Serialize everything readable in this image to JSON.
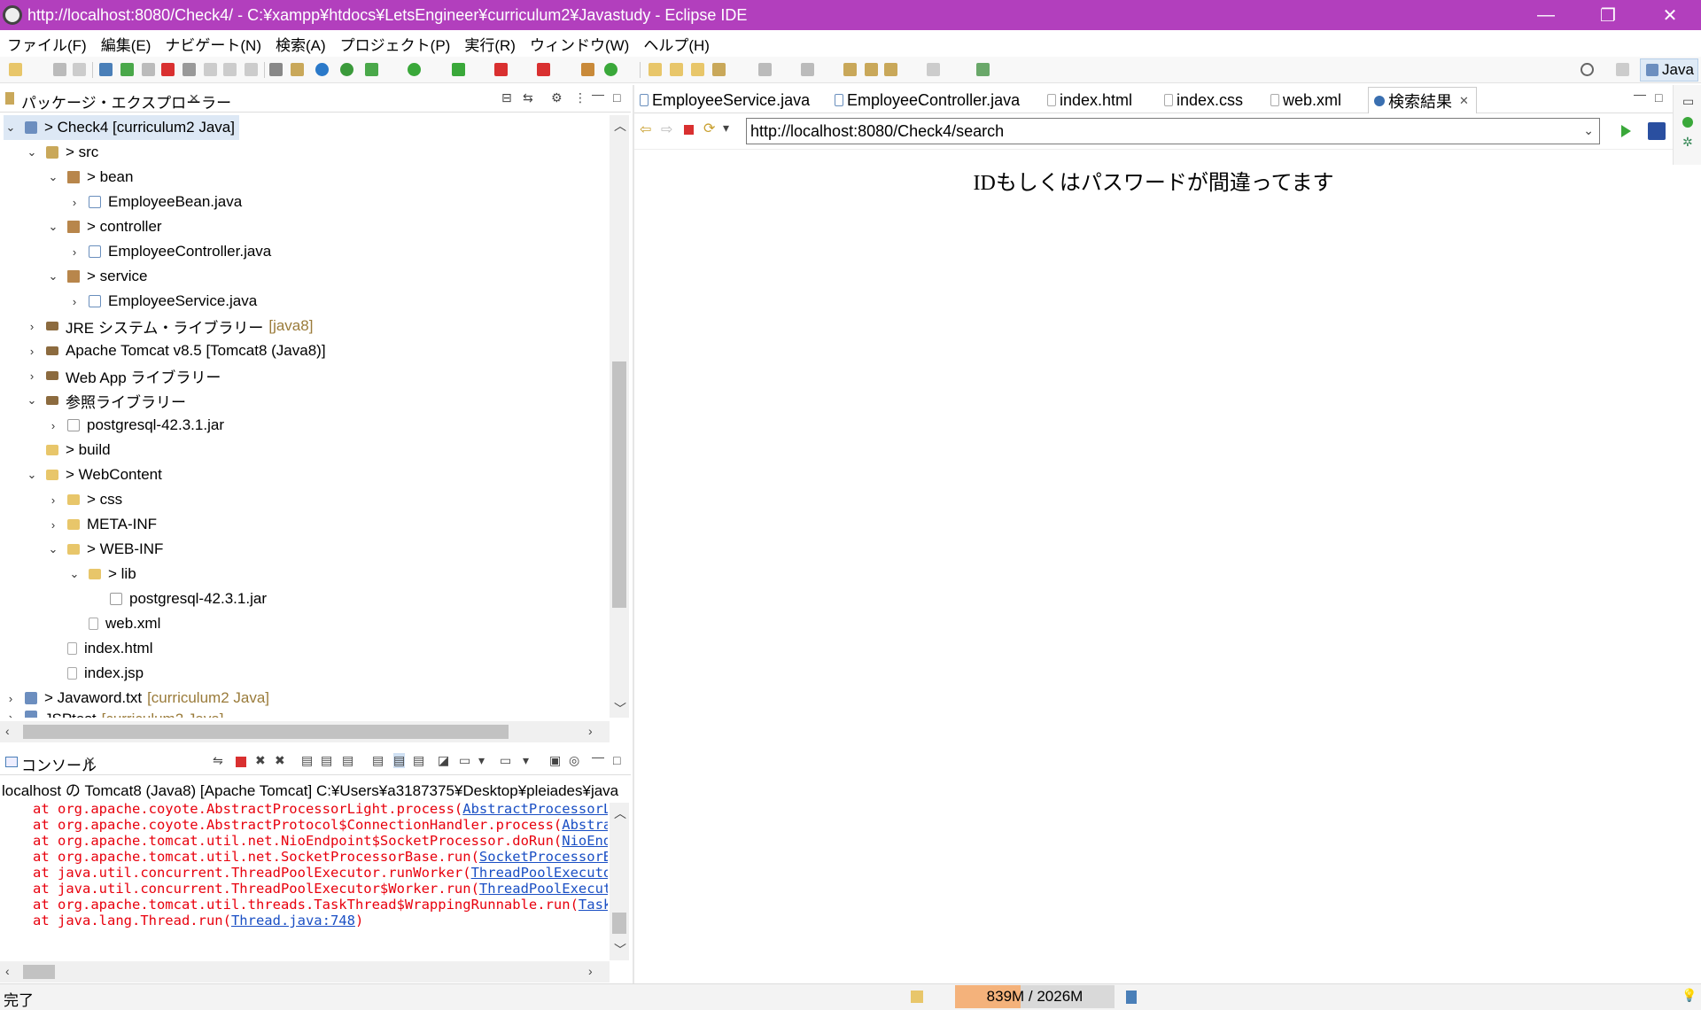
{
  "window": {
    "title": "http://localhost:8080/Check4/ - C:¥xampp¥htdocs¥LetsEngineer¥curriculum2¥Javastudy - Eclipse IDE",
    "minimize": "—",
    "restore": "❐",
    "close": "✕"
  },
  "menu": [
    "ファイル(F)",
    "編集(E)",
    "ナビゲート(N)",
    "検索(A)",
    "プロジェクト(P)",
    "実行(R)",
    "ウィンドウ(W)",
    "ヘルプ(H)"
  ],
  "perspective": {
    "label": "Java",
    "icon": "java-perspective-icon"
  },
  "package_explorer": {
    "title": "パッケージ・エクスプローラー",
    "items": [
      {
        "label": "> Check4 [curriculum2 Java]",
        "decoration": "",
        "icon": "project-icon",
        "twisty": "⌄",
        "selected": true
      },
      {
        "label": "> src",
        "decoration": "",
        "icon": "source-folder-icon",
        "twisty": "⌄"
      },
      {
        "label": "> bean",
        "decoration": "",
        "icon": "package-icon",
        "twisty": "⌄"
      },
      {
        "label": "EmployeeBean.java",
        "decoration": "",
        "icon": "java-file-icon",
        "twisty": "›"
      },
      {
        "label": "> controller",
        "decoration": "",
        "icon": "package-icon",
        "twisty": "⌄"
      },
      {
        "label": "EmployeeController.java",
        "decoration": "",
        "icon": "java-file-icon",
        "twisty": "›"
      },
      {
        "label": "> service",
        "decoration": "",
        "icon": "package-icon",
        "twisty": "⌄"
      },
      {
        "label": "EmployeeService.java",
        "decoration": "",
        "icon": "java-file-icon",
        "twisty": "›"
      },
      {
        "label": "JRE システム・ライブラリー",
        "decoration": "[java8]",
        "icon": "library-icon",
        "twisty": "›"
      },
      {
        "label": "Apache Tomcat v8.5 [Tomcat8 (Java8)]",
        "decoration": "",
        "icon": "library-icon",
        "twisty": "›"
      },
      {
        "label": "Web App ライブラリー",
        "decoration": "",
        "icon": "library-icon",
        "twisty": "›"
      },
      {
        "label": "参照ライブラリー",
        "decoration": "",
        "icon": "library-icon",
        "twisty": "⌄"
      },
      {
        "label": "postgresql-42.3.1.jar",
        "decoration": "",
        "icon": "jar-icon",
        "twisty": "›"
      },
      {
        "label": "> build",
        "decoration": "",
        "icon": "folder-icon",
        "twisty": ""
      },
      {
        "label": "> WebContent",
        "decoration": "",
        "icon": "folder-icon",
        "twisty": "⌄"
      },
      {
        "label": "> css",
        "decoration": "",
        "icon": "folder-icon",
        "twisty": "›"
      },
      {
        "label": "META-INF",
        "decoration": "",
        "icon": "folder-icon",
        "twisty": "›"
      },
      {
        "label": "> WEB-INF",
        "decoration": "",
        "icon": "folder-icon",
        "twisty": "⌄"
      },
      {
        "label": "> lib",
        "decoration": "",
        "icon": "folder-icon",
        "twisty": "⌄"
      },
      {
        "label": "postgresql-42.3.1.jar",
        "decoration": "",
        "icon": "jar-icon",
        "twisty": ""
      },
      {
        "label": "web.xml",
        "decoration": "",
        "icon": "xml-file-icon",
        "twisty": ""
      },
      {
        "label": "index.html",
        "decoration": "",
        "icon": "html-file-icon",
        "twisty": ""
      },
      {
        "label": "index.jsp",
        "decoration": "",
        "icon": "jsp-file-icon",
        "twisty": ""
      },
      {
        "label": "> Javaword.txt",
        "decoration": "[curriculum2 Java]",
        "icon": "project-icon",
        "twisty": "›"
      },
      {
        "label": "JSPtest",
        "decoration": "[curriculum2 Java]",
        "icon": "project-icon",
        "twisty": "›"
      }
    ]
  },
  "console": {
    "title": "コンソール",
    "description": "localhost の Tomcat8 (Java8) [Apache Tomcat] C:¥Users¥a3187375¥Desktop¥pleiades¥java",
    "lines": [
      {
        "prefix": "at org.apache.coyote.AbstractProcessorLight.process(",
        "link": "AbstractProcessorLig"
      },
      {
        "prefix": "at org.apache.coyote.AbstractProtocol$ConnectionHandler.process(",
        "link": "Abstract"
      },
      {
        "prefix": "at org.apache.tomcat.util.net.NioEndpoint$SocketProcessor.doRun(",
        "link": "NioEndpo"
      },
      {
        "prefix": "at org.apache.tomcat.util.net.SocketProcessorBase.run(",
        "link": "SocketProcessorBas"
      },
      {
        "prefix": "at java.util.concurrent.ThreadPoolExecutor.runWorker(",
        "link": "ThreadPoolExecutor."
      },
      {
        "prefix": "at java.util.concurrent.ThreadPoolExecutor$Worker.run(",
        "link": "ThreadPoolExecutor"
      },
      {
        "prefix": "at org.apache.tomcat.util.threads.TaskThread$WrappingRunnable.run(",
        "link": "TaskTh"
      },
      {
        "prefix": "at java.lang.Thread.run(",
        "link": "Thread.java:748",
        "suffix": ")"
      }
    ]
  },
  "editor_tabs": [
    {
      "label": "EmployeeService.java",
      "icon": "java-file-icon"
    },
    {
      "label": "EmployeeController.java",
      "icon": "java-file-icon"
    },
    {
      "label": "index.html",
      "icon": "html-file-icon"
    },
    {
      "label": "index.css",
      "icon": "css-file-icon"
    },
    {
      "label": "web.xml",
      "icon": "xml-file-icon"
    },
    {
      "label": "検索結果",
      "icon": "globe-icon",
      "active": true
    }
  ],
  "browser": {
    "url": "http://localhost:8080/Check4/search",
    "message": "IDもしくはパスワードが間違ってます"
  },
  "status": {
    "text": "完了",
    "heap_label": "839M / 2026M",
    "heap_used_fraction": 0.41
  },
  "colors": {
    "titlebar": "#b23fbd",
    "console_error": "#e8000d",
    "link": "#1a4fc4",
    "heap_fill": "#f4b27b"
  }
}
